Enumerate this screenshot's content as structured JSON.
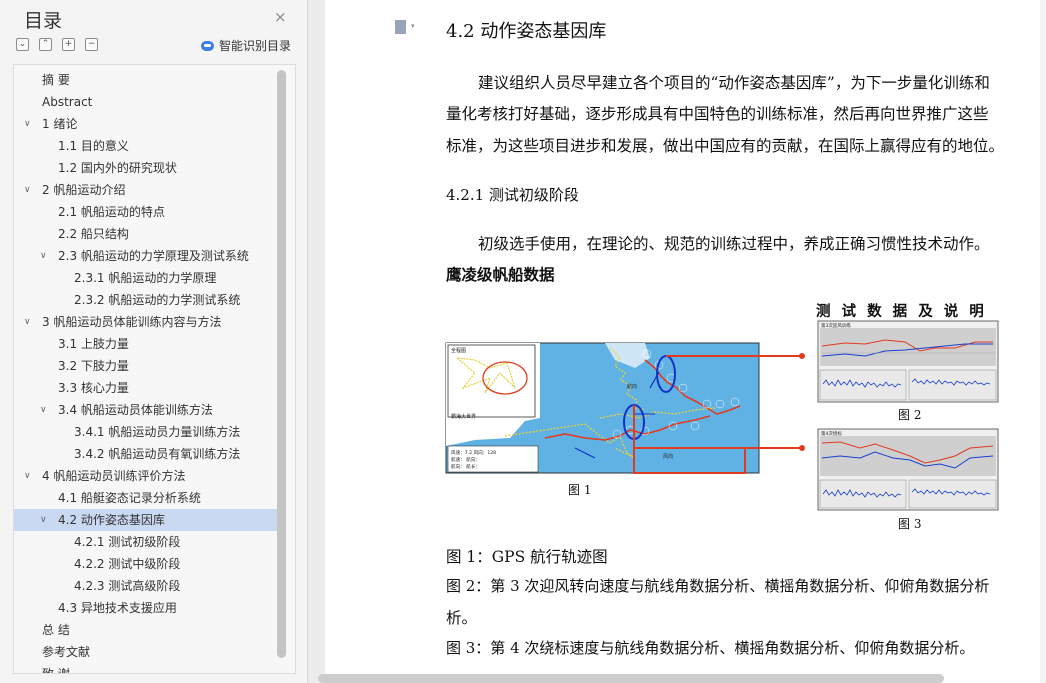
{
  "toc": {
    "title": "目录",
    "close_icon": "×",
    "smart_toc_label": "智能识别目录",
    "tool_buttons": [
      "⌄",
      "⌃",
      "+",
      "−"
    ],
    "items": [
      {
        "label": "摘  要",
        "level": 0,
        "chev": ""
      },
      {
        "label": "Abstract",
        "level": 0,
        "chev": ""
      },
      {
        "label": "1 绪论",
        "level": 0,
        "chev": "∨"
      },
      {
        "label": "1.1 目的意义",
        "level": 1,
        "chev": ""
      },
      {
        "label": "1.2 国内外的研究现状",
        "level": 1,
        "chev": ""
      },
      {
        "label": "2 帆船运动介绍",
        "level": 0,
        "chev": "∨"
      },
      {
        "label": "2.1 帆船运动的特点",
        "level": 1,
        "chev": ""
      },
      {
        "label": "2.2 船只结构",
        "level": 1,
        "chev": ""
      },
      {
        "label": "2.3 帆船运动的力学原理及测试系统",
        "level": 1,
        "chev": "∨"
      },
      {
        "label": "2.3.1 帆船运动的力学原理",
        "level": 2,
        "chev": ""
      },
      {
        "label": "2.3.2 帆船运动的力学测试系统",
        "level": 2,
        "chev": ""
      },
      {
        "label": "3 帆船运动员体能训练内容与方法",
        "level": 0,
        "chev": "∨"
      },
      {
        "label": "3.1 上肢力量",
        "level": 1,
        "chev": ""
      },
      {
        "label": "3.2 下肢力量",
        "level": 1,
        "chev": ""
      },
      {
        "label": "3.3 核心力量",
        "level": 1,
        "chev": ""
      },
      {
        "label": "3.4 帆船运动员体能训练方法",
        "level": 1,
        "chev": "∨"
      },
      {
        "label": "3.4.1 帆船运动员力量训练方法",
        "level": 2,
        "chev": ""
      },
      {
        "label": "3.4.2 帆船运动员有氧训练方法",
        "level": 2,
        "chev": ""
      },
      {
        "label": "4 帆船运动员训练评价方法",
        "level": 0,
        "chev": "∨"
      },
      {
        "label": "4.1 船艇姿态记录分析系统",
        "level": 1,
        "chev": ""
      },
      {
        "label": "4.2 动作姿态基因库",
        "level": 1,
        "chev": "∨",
        "selected": true
      },
      {
        "label": "4.2.1 测试初级阶段",
        "level": 2,
        "chev": ""
      },
      {
        "label": "4.2.2 测试中级阶段",
        "level": 2,
        "chev": ""
      },
      {
        "label": "4.2.3 测试高级阶段",
        "level": 2,
        "chev": ""
      },
      {
        "label": "4.3 异地技术支援应用",
        "level": 1,
        "chev": ""
      },
      {
        "label": "总  结",
        "level": 0,
        "chev": ""
      },
      {
        "label": "参考文献",
        "level": 0,
        "chev": ""
      },
      {
        "label": "致  谢",
        "level": 0,
        "chev": ""
      }
    ]
  },
  "doc": {
    "heading": "4.2 动作姿态基因库",
    "para1": [
      "建议组织人员尽早建立各个项目的“动作姿态基因库”，为下一步量化训练和",
      "量化考核打好基础，逐步形成具有中国特色的训练标准，然后再向世界推广这些",
      "标准，为这些项目进步和发展，做出中国应有的贡献，在国际上赢得应有的地位。"
    ],
    "subheading": "4.2.1 测试初级阶段",
    "para2": "初级选手使用，在理论的、规范的训练过程中，养成正确习惯性技术动作。",
    "bold_title": "鹰凌级帆船数据",
    "figure": {
      "title": "测 试 数 据 及 说 明",
      "map_labels": {
        "overview": "全程图",
        "area": "霸海大世界",
        "wind": "风向",
        "course": "航向"
      },
      "map_stats": [
        "风速：7.2  风向：128",
        "航速：   航向：",
        "航向：   航长："
      ],
      "labels": {
        "fig1": "图 1",
        "fig2": "图 2",
        "fig3": "图 3"
      },
      "panel2_title": "第3次迎风训练",
      "panel3_title": "第4次绕标"
    },
    "captions": [
      "图 1：GPS 航行轨迹图",
      "图 2：第 3 次迎风转向速度与航线角数据分析、横摇角数据分析、仰俯角数据分析",
      "析。",
      "图 3：第 4 次绕标速度与航线角数据分析、横摇角数据分析、仰俯角数据分析。"
    ]
  },
  "colors": {
    "accent": "#3a7ee6",
    "selected": "#c9d9f2",
    "track": "#e23a1f",
    "sea": "#5fb2e3"
  }
}
